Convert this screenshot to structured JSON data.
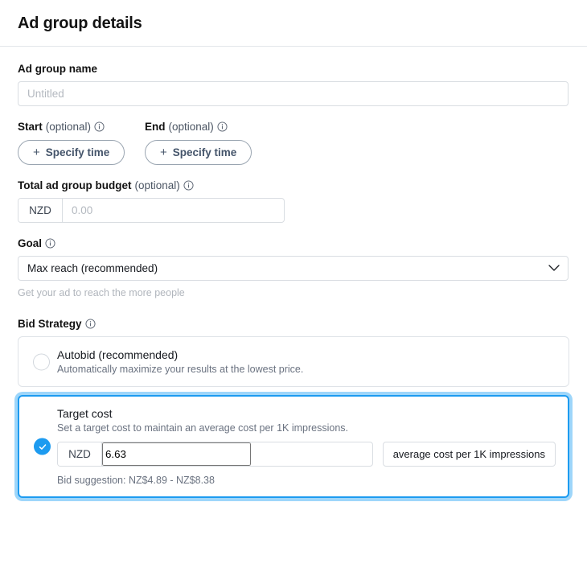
{
  "header": {
    "title": "Ad group details"
  },
  "icons": {
    "info": "info-icon",
    "chevron_down": "chevron-down-icon",
    "plus": "+",
    "check": "check-icon"
  },
  "colors": {
    "accent": "#1d9bf0",
    "accent_glow": "#9ed6fa",
    "border": "#d9dde2",
    "text": "#16191f",
    "muted": "#6a7280",
    "placeholder": "#b4b9c0"
  },
  "ad_group_name": {
    "label": "Ad group name",
    "value": "",
    "placeholder": "Untitled"
  },
  "start": {
    "label": "Start",
    "optional": "(optional)",
    "button_label": "Specify time",
    "plus": "+"
  },
  "end": {
    "label": "End",
    "optional": "(optional)",
    "button_label": "Specify time",
    "plus": "+"
  },
  "budget": {
    "label": "Total ad group budget",
    "optional": "(optional)",
    "currency": "NZD",
    "value": "",
    "placeholder": "0.00"
  },
  "goal": {
    "label": "Goal",
    "selected": "Max reach (recommended)",
    "options": [
      "Max reach (recommended)"
    ],
    "helper": "Get your ad to reach the more people"
  },
  "bid_strategy": {
    "label": "Bid Strategy",
    "options": [
      {
        "id": "autobid",
        "title": "Autobid (recommended)",
        "description": "Automatically maximize your results at the lowest price.",
        "selected": false
      },
      {
        "id": "target-cost",
        "title": "Target cost",
        "description": "Set a target cost to maintain an average cost per 1K impressions.",
        "selected": true,
        "currency": "NZD",
        "value": "6.63",
        "suffix": "average cost per 1K impressions",
        "bid_suggestion": "Bid suggestion: NZ$4.89 - NZ$8.38"
      }
    ]
  }
}
